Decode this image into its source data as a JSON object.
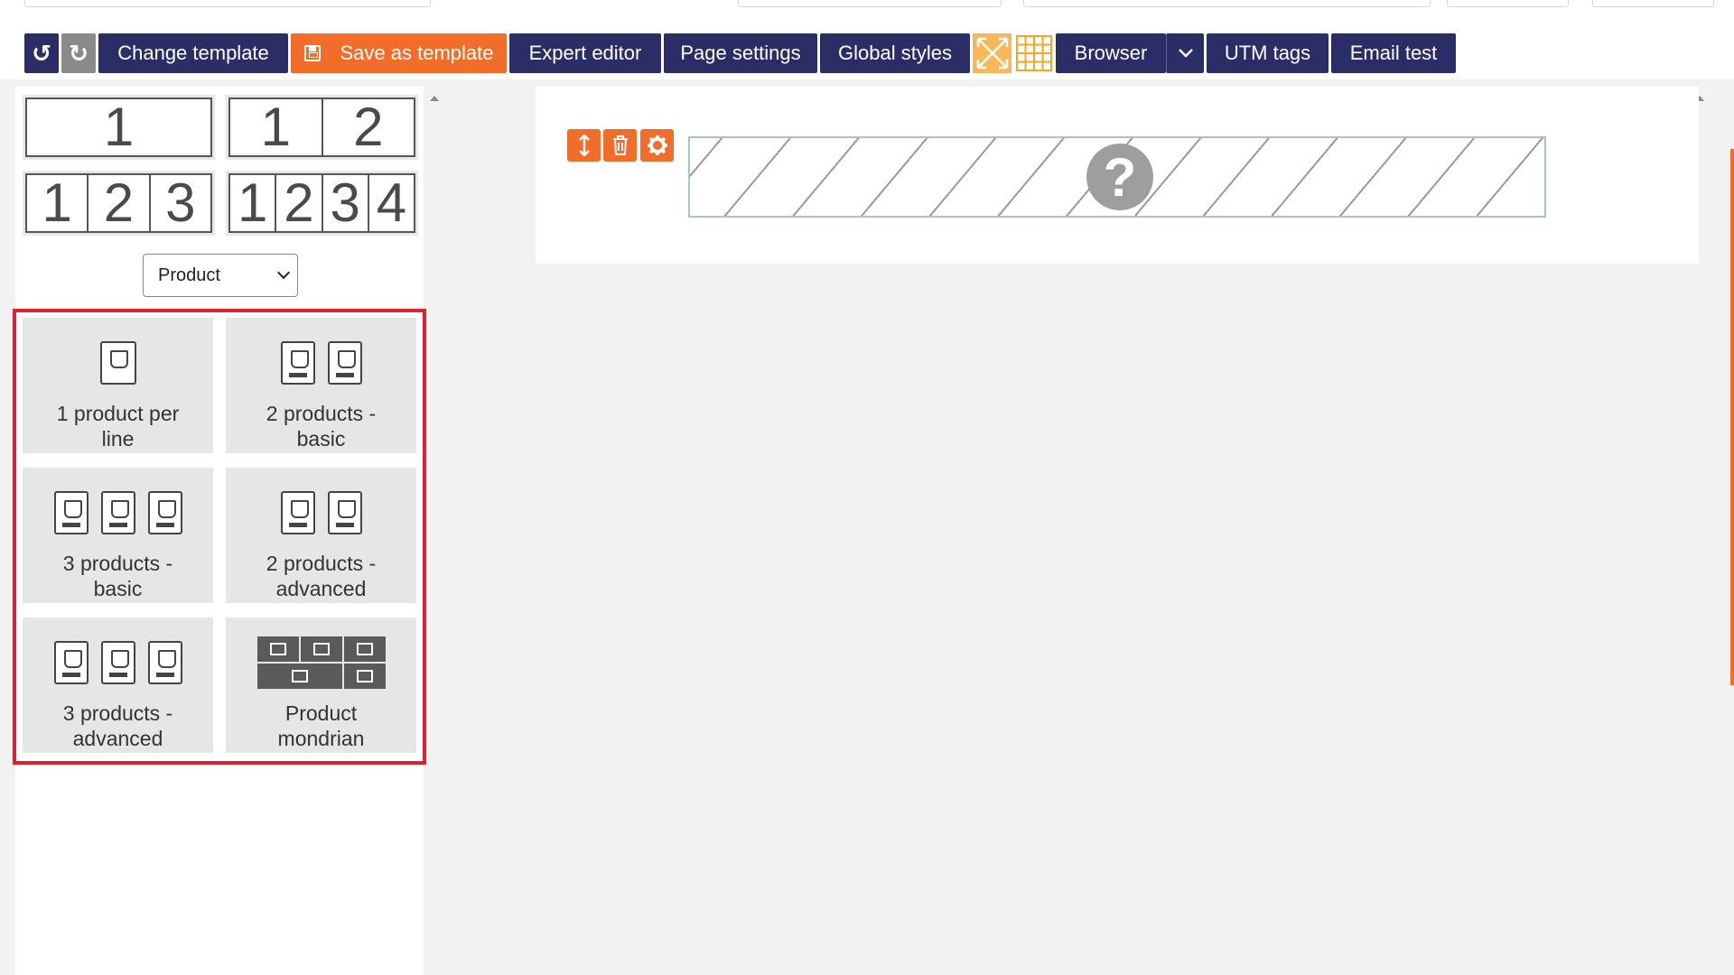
{
  "toolbar": {
    "undo_icon": "undo-icon",
    "redo_icon": "redo-icon",
    "change_template": "Change template",
    "save_as_template": "Save as template",
    "expert_editor": "Expert editor",
    "page_settings": "Page settings",
    "global_styles": "Global styles",
    "browser": "Browser",
    "utm_tags": "UTM tags",
    "email_test": "Email test"
  },
  "layouts": {
    "one": [
      "1"
    ],
    "two": [
      "1",
      "2"
    ],
    "three": [
      "1",
      "2",
      "3"
    ],
    "four": [
      "1",
      "2",
      "3",
      "4"
    ]
  },
  "category_select": {
    "value": "Product"
  },
  "blocks": [
    {
      "label": "1 product per line"
    },
    {
      "label": "2 products - basic"
    },
    {
      "label": "3 products - basic"
    },
    {
      "label": "2 products - advanced"
    },
    {
      "label": "3 products - advanced"
    },
    {
      "label": "Product mondrian"
    }
  ],
  "canvas": {
    "placeholder_glyph": "?"
  },
  "colors": {
    "navy": "#2b2d66",
    "orange": "#f26c2a",
    "highlight": "#e02030"
  }
}
